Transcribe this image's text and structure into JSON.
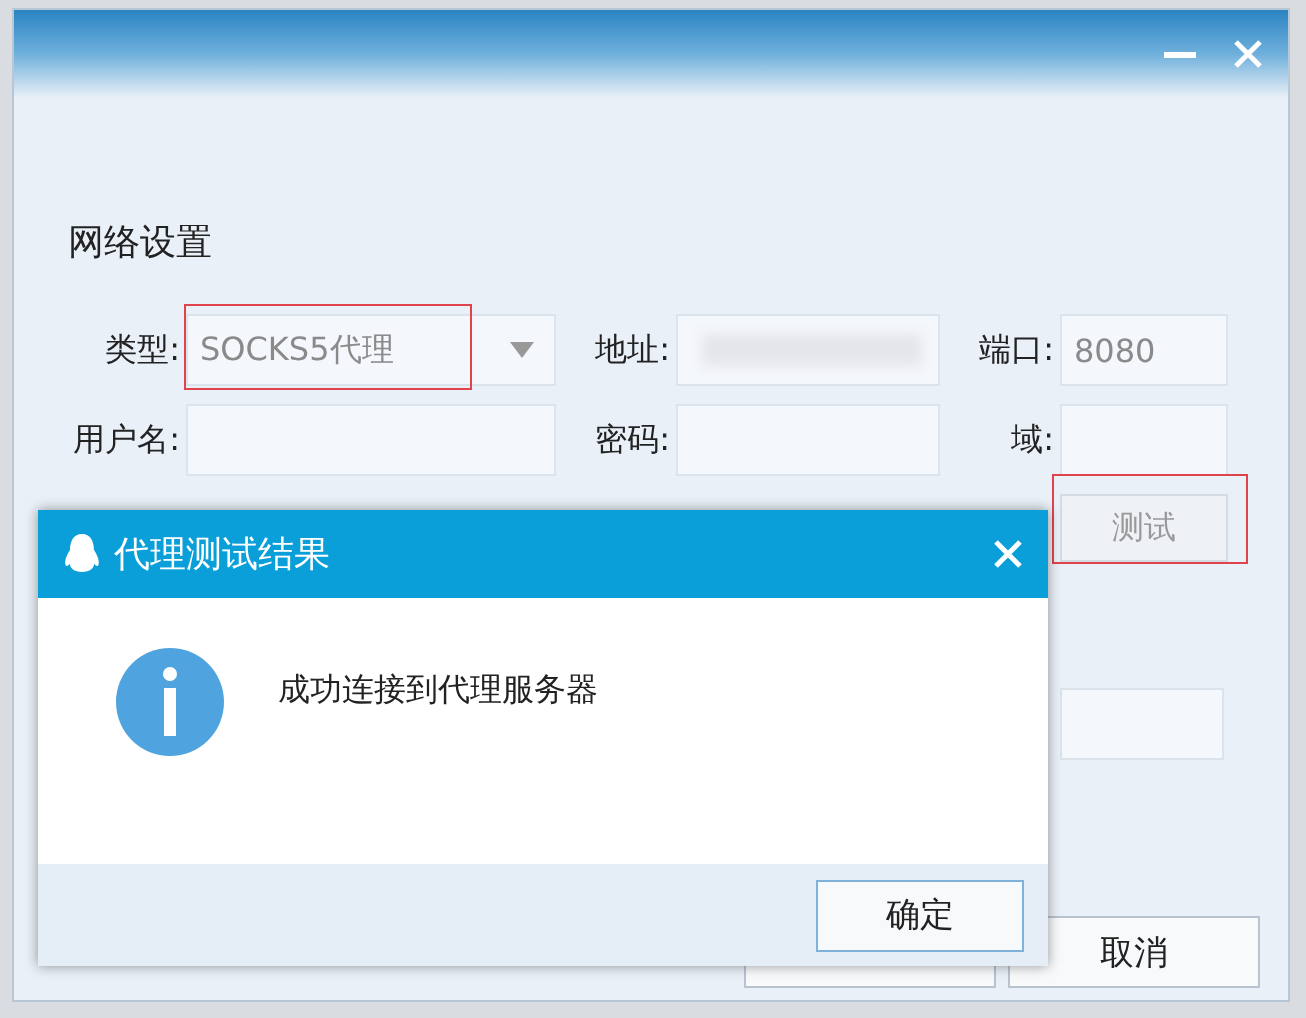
{
  "section_title": "网络设置",
  "fields": [
    {
      "label": "类型:",
      "kind": "select",
      "value": "SOCKS5代理",
      "highlighted": true
    },
    {
      "label": "地址:",
      "kind": "redacted",
      "highlighted": false
    },
    {
      "label": "端口:",
      "kind": "text",
      "value": "8080",
      "highlighted": false
    },
    {
      "label": "用户名:",
      "kind": "text",
      "highlighted": false
    },
    {
      "label": "密码:",
      "kind": "text",
      "highlighted": false
    },
    {
      "label": "域:",
      "kind": "text",
      "highlighted": false
    }
  ],
  "test_button": {
    "label": "测试",
    "highlighted": true
  },
  "cancel_button": "取消",
  "dialog": {
    "title": "代理测试结果",
    "message": "成功连接到代理服务器",
    "ok_button": "确定"
  }
}
